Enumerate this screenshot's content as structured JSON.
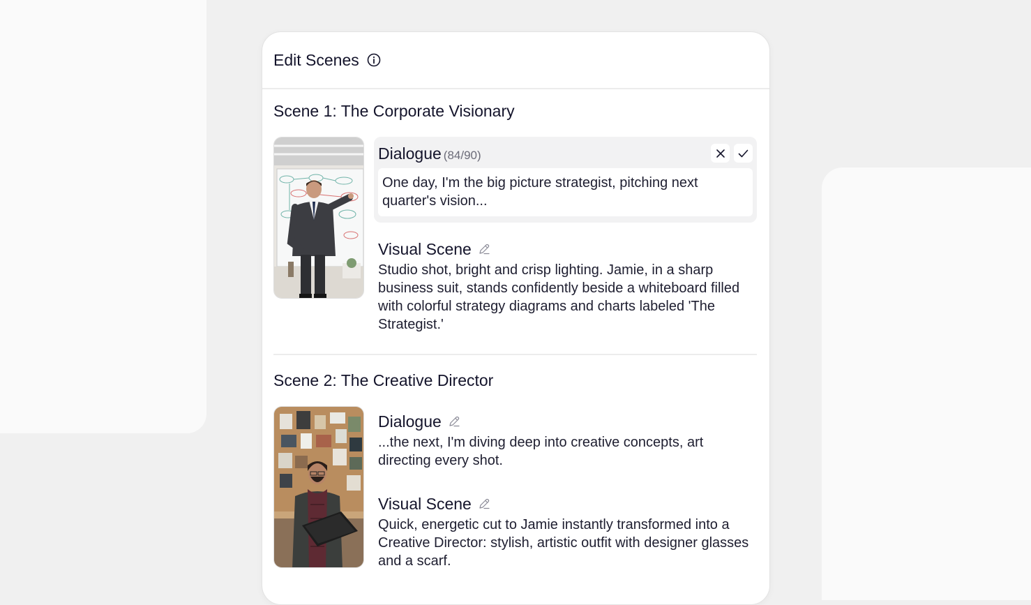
{
  "panel": {
    "title": "Edit Scenes"
  },
  "scenes": [
    {
      "title": "Scene 1: The Corporate Visionary",
      "dialogue": {
        "label": "Dialogue",
        "counter": "(84/90)",
        "value": "One day, I'm the big picture strategist, pitching next quarter's vision..."
      },
      "visual": {
        "label": "Visual Scene",
        "text": "Studio shot, bright and crisp lighting. Jamie, in a sharp business suit, stands confidently beside a whiteboard filled with colorful strategy diagrams and charts labeled 'The Strategist.'"
      }
    },
    {
      "title": "Scene 2: The Creative Director",
      "dialogue": {
        "label": "Dialogue",
        "text": "...the next, I'm diving deep into creative concepts, art directing every shot."
      },
      "visual": {
        "label": "Visual Scene",
        "text": "Quick, energetic cut to Jamie instantly transformed into a Creative Director: stylish, artistic outfit with designer glasses and a scarf."
      }
    }
  ],
  "icons": {
    "info": "info-icon",
    "edit": "pencil-icon",
    "cancel": "close-icon",
    "confirm": "check-icon"
  },
  "colors": {
    "text": "#14142b",
    "muted": "#6b6b78",
    "panel_bg": "#ffffff",
    "page_bg": "#f0f0f0"
  }
}
